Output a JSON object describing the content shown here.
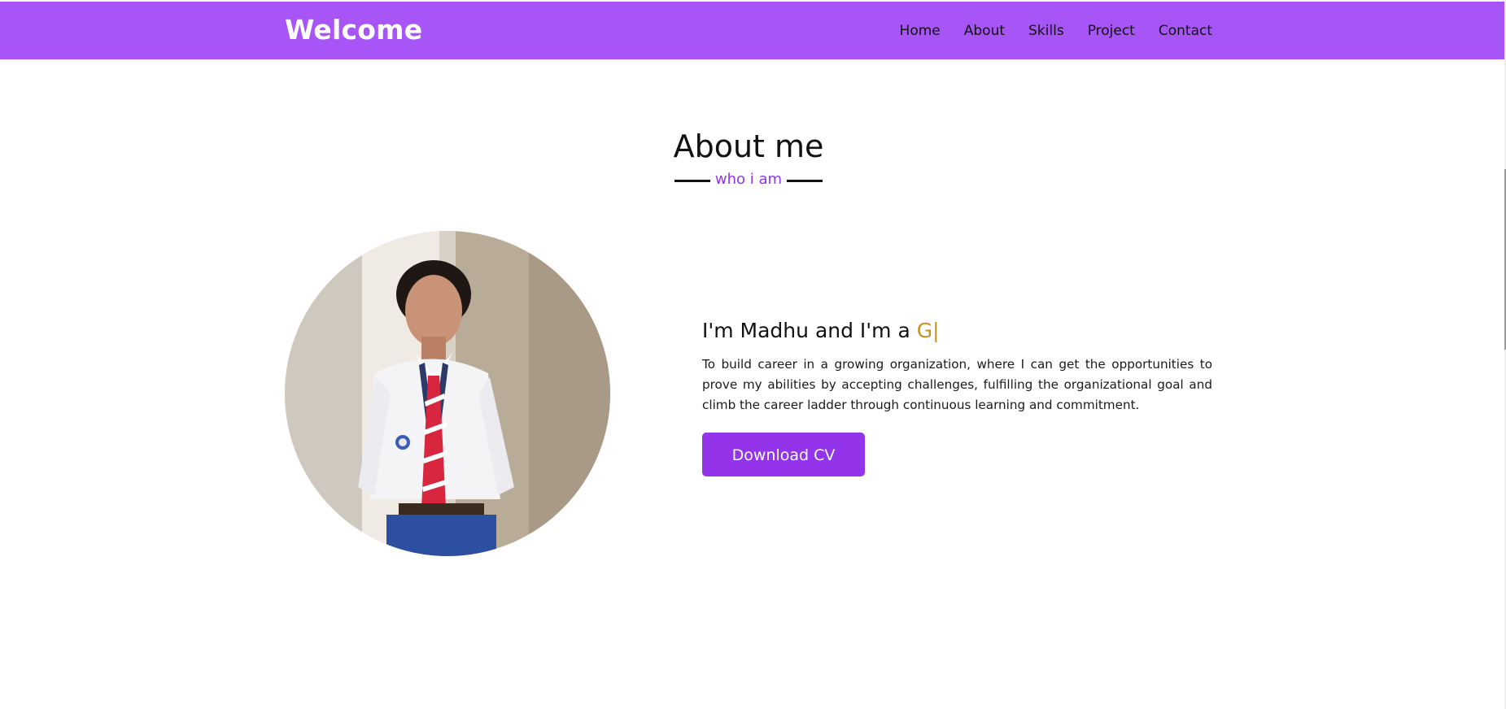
{
  "colors": {
    "accent": "#a855f7",
    "purple": "#9333ea",
    "gold": "#c7921f",
    "button": "#9333ea"
  },
  "navbar": {
    "logo": "Welcome",
    "links": [
      "Home",
      "About",
      "Skills",
      "Project",
      "Contact"
    ]
  },
  "about": {
    "title": "About me",
    "subtitle": "who i am",
    "intro_prefix": "I'm Madhu and I'm a ",
    "typed_text": "G",
    "cursor": "|",
    "description": "To build career in a growing organization, where I can get the opportunities to prove my abilities by accepting challenges, fulfilling the organizational goal and climb the career ladder through continuous learning and commitment.",
    "button_label": "Download CV"
  }
}
